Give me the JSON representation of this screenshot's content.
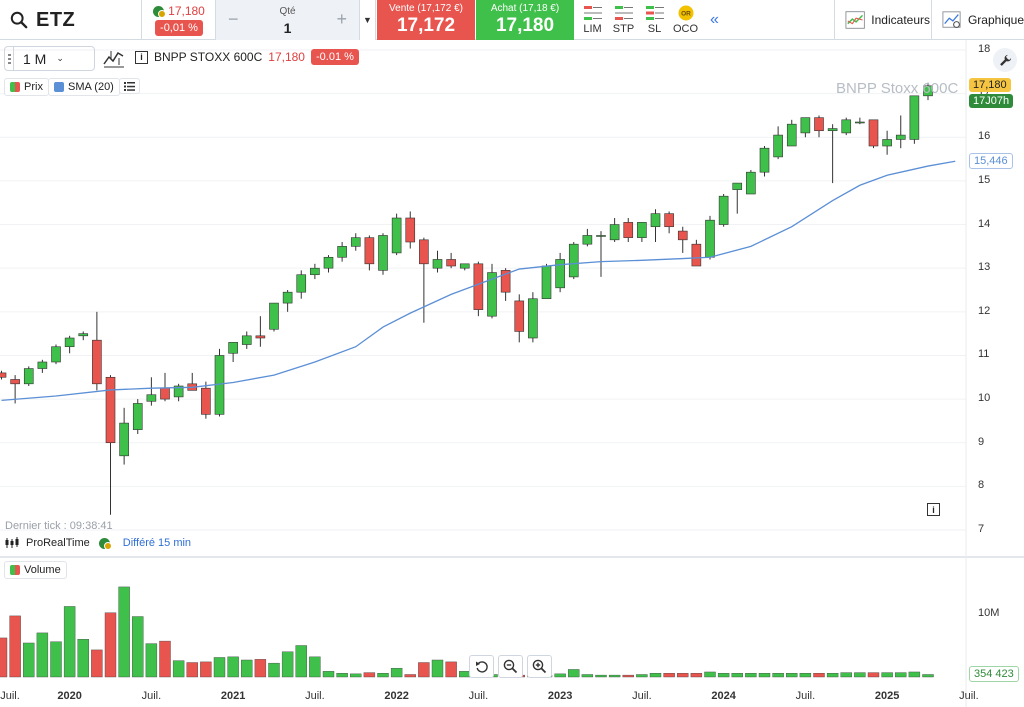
{
  "header": {
    "symbol": "ETZ",
    "last_price": "17,180",
    "change": "-0,01 %",
    "qty_label": "Qté",
    "qty_value": "1",
    "sell_label": "Vente (17,172 €)",
    "sell_price": "17,172",
    "buy_label": "Achat (17,18 €)",
    "buy_price": "17,180",
    "order_types": [
      "LIM",
      "STP",
      "SL",
      "OCO"
    ],
    "oco_badge": "OR",
    "indicators_label": "Indicateurs",
    "chart_label": "Graphique"
  },
  "chart_header": {
    "period": "1 M",
    "instrument": "BNPP STOXX 600C",
    "price": "17,180",
    "change": "-0.01 %",
    "watermark": "BNPP Stoxx 600C",
    "legend_price": "Prix",
    "legend_sma": "SMA (20)",
    "volume_label": "Volume",
    "last_tick": "Dernier tick : 09:38:41",
    "source": "ProRealTime",
    "delay": "Différé 15 min"
  },
  "tags": {
    "price": "17,180",
    "countdown": "17J07h",
    "sma": "15,446",
    "volume": "354 423",
    "volume_axis": "10M"
  },
  "colors": {
    "up": "#3fc04a",
    "down": "#e8544e",
    "sma": "#5b8fd6",
    "accent": "#3b7ae0"
  },
  "chart_data": {
    "type": "candlestick",
    "interval": "1 M",
    "y_ticks": [
      "18",
      "17",
      "16",
      "15",
      "14",
      "13",
      "12",
      "11",
      "10",
      "9",
      "8",
      "7"
    ],
    "ylim": [
      6.6,
      18.3
    ],
    "x_ticks": [
      {
        "label": "Juil.",
        "i": -1
      },
      {
        "label": "2020",
        "i": 5,
        "year": true
      },
      {
        "label": "Juil.",
        "i": 11
      },
      {
        "label": "2021",
        "i": 17,
        "year": true
      },
      {
        "label": "Juil.",
        "i": 23
      },
      {
        "label": "2022",
        "i": 29,
        "year": true
      },
      {
        "label": "Juil.",
        "i": 35
      },
      {
        "label": "2023",
        "i": 41,
        "year": true
      },
      {
        "label": "Juil.",
        "i": 47
      },
      {
        "label": "2024",
        "i": 53,
        "year": true
      },
      {
        "label": "Juil.",
        "i": 59
      },
      {
        "label": "2025",
        "i": 65,
        "year": true
      },
      {
        "label": "Juil.",
        "i": 71
      }
    ],
    "ohlc": [
      [
        10.6,
        10.65,
        10.45,
        10.5
      ],
      [
        10.45,
        10.55,
        9.9,
        10.35
      ],
      [
        10.35,
        10.75,
        10.3,
        10.7
      ],
      [
        10.7,
        10.9,
        10.6,
        10.85
      ],
      [
        10.85,
        11.25,
        10.8,
        11.2
      ],
      [
        11.2,
        11.45,
        11.05,
        11.4
      ],
      [
        11.45,
        11.55,
        11.35,
        11.5
      ],
      [
        11.35,
        12.0,
        10.2,
        10.35
      ],
      [
        10.5,
        10.55,
        7.35,
        9.0
      ],
      [
        8.7,
        9.8,
        8.5,
        9.45
      ],
      [
        9.3,
        10.0,
        9.2,
        9.9
      ],
      [
        9.95,
        10.5,
        9.85,
        10.1
      ],
      [
        10.25,
        10.6,
        9.95,
        10.0
      ],
      [
        10.05,
        10.35,
        9.95,
        10.3
      ],
      [
        10.35,
        10.6,
        10.2,
        10.2
      ],
      [
        10.25,
        10.4,
        9.55,
        9.65
      ],
      [
        9.65,
        11.15,
        9.6,
        11.0
      ],
      [
        11.05,
        11.3,
        10.85,
        11.3
      ],
      [
        11.25,
        11.55,
        11.15,
        11.45
      ],
      [
        11.45,
        11.9,
        11.2,
        11.4
      ],
      [
        11.6,
        12.2,
        11.55,
        12.2
      ],
      [
        12.2,
        12.5,
        12.0,
        12.45
      ],
      [
        12.45,
        12.95,
        12.3,
        12.85
      ],
      [
        12.85,
        13.1,
        12.75,
        13.0
      ],
      [
        13.0,
        13.3,
        12.9,
        13.25
      ],
      [
        13.25,
        13.6,
        13.15,
        13.5
      ],
      [
        13.5,
        13.8,
        13.4,
        13.7
      ],
      [
        13.7,
        13.75,
        12.95,
        13.1
      ],
      [
        12.95,
        13.8,
        12.85,
        13.75
      ],
      [
        13.35,
        14.25,
        13.3,
        14.15
      ],
      [
        14.15,
        14.3,
        13.45,
        13.6
      ],
      [
        13.65,
        13.7,
        11.75,
        13.1
      ],
      [
        13.0,
        13.4,
        12.9,
        13.2
      ],
      [
        13.2,
        13.35,
        13.0,
        13.05
      ],
      [
        13.0,
        13.1,
        12.95,
        13.1
      ],
      [
        13.1,
        13.15,
        11.9,
        12.05
      ],
      [
        11.9,
        13.1,
        11.85,
        12.9
      ],
      [
        12.95,
        13.0,
        12.25,
        12.45
      ],
      [
        12.25,
        12.4,
        11.3,
        11.55
      ],
      [
        11.4,
        12.45,
        11.3,
        12.3
      ],
      [
        12.3,
        13.1,
        12.3,
        13.05
      ],
      [
        12.55,
        13.35,
        12.45,
        13.2
      ],
      [
        12.8,
        13.6,
        12.75,
        13.55
      ],
      [
        13.55,
        13.9,
        13.5,
        13.75
      ],
      [
        13.75,
        13.85,
        12.8,
        13.75
      ],
      [
        13.65,
        14.15,
        13.6,
        14.0
      ],
      [
        14.05,
        14.15,
        13.6,
        13.7
      ],
      [
        13.7,
        14.05,
        13.6,
        14.05
      ],
      [
        13.95,
        14.35,
        13.6,
        14.25
      ],
      [
        14.25,
        14.3,
        13.8,
        13.95
      ],
      [
        13.85,
        13.95,
        13.35,
        13.65
      ],
      [
        13.55,
        13.65,
        13.1,
        13.05
      ],
      [
        13.25,
        14.2,
        13.2,
        14.1
      ],
      [
        14.0,
        14.7,
        13.95,
        14.65
      ],
      [
        14.8,
        14.95,
        14.25,
        14.95
      ],
      [
        14.7,
        15.25,
        14.7,
        15.2
      ],
      [
        15.2,
        15.8,
        15.1,
        15.75
      ],
      [
        15.55,
        16.25,
        15.5,
        16.05
      ],
      [
        15.8,
        16.4,
        15.8,
        16.3
      ],
      [
        16.1,
        16.45,
        16.0,
        16.45
      ],
      [
        16.45,
        16.5,
        16.0,
        16.15
      ],
      [
        16.15,
        16.3,
        14.95,
        16.2
      ],
      [
        16.1,
        16.45,
        16.05,
        16.4
      ],
      [
        16.35,
        16.45,
        16.3,
        16.35
      ],
      [
        16.4,
        16.4,
        15.75,
        15.8
      ],
      [
        15.8,
        16.15,
        15.6,
        15.95
      ],
      [
        15.95,
        16.5,
        15.75,
        16.05
      ],
      [
        15.95,
        16.85,
        15.85,
        16.95
      ],
      [
        16.95,
        17.25,
        16.85,
        17.18
      ]
    ],
    "sma20": [
      [
        0,
        9.97
      ],
      [
        4,
        10.07
      ],
      [
        8,
        10.21
      ],
      [
        11,
        10.25
      ],
      [
        14,
        10.27
      ],
      [
        17,
        10.38
      ],
      [
        20,
        10.55
      ],
      [
        23,
        10.85
      ],
      [
        26,
        11.2
      ],
      [
        28,
        11.65
      ],
      [
        30,
        11.97
      ],
      [
        33,
        12.4
      ],
      [
        36,
        12.75
      ],
      [
        38,
        12.98
      ],
      [
        41,
        13.08
      ],
      [
        44,
        13.15
      ],
      [
        47,
        13.18
      ],
      [
        50,
        13.22
      ],
      [
        52,
        13.25
      ],
      [
        55,
        13.5
      ],
      [
        58,
        13.95
      ],
      [
        61,
        14.55
      ],
      [
        63,
        14.9
      ],
      [
        65,
        15.13
      ],
      [
        68,
        15.34
      ],
      [
        70,
        15.45
      ]
    ],
    "volume_ticks": [
      "10M"
    ],
    "volume_max": 20.0,
    "volume_millions": [
      6.2,
      9.7,
      5.4,
      7.0,
      5.6,
      11.2,
      6.0,
      4.3,
      10.2,
      14.3,
      9.6,
      5.3,
      5.7,
      2.6,
      2.3,
      2.4,
      3.1,
      3.2,
      2.7,
      2.8,
      2.2,
      4.0,
      5.0,
      3.2,
      0.9,
      0.6,
      0.5,
      0.7,
      0.6,
      1.4,
      0.4,
      2.3,
      2.7,
      2.4,
      0.9,
      0.5,
      0.4,
      0.3,
      0.3,
      0.3,
      0.3,
      0.5,
      1.2,
      0.4,
      0.3,
      0.3,
      0.3,
      0.4,
      0.6,
      0.6,
      0.6,
      0.6,
      0.8,
      0.6,
      0.6,
      0.6,
      0.6,
      0.6,
      0.6,
      0.6,
      0.6,
      0.6,
      0.7,
      0.7,
      0.7,
      0.7,
      0.7,
      0.8,
      0.4
    ]
  }
}
